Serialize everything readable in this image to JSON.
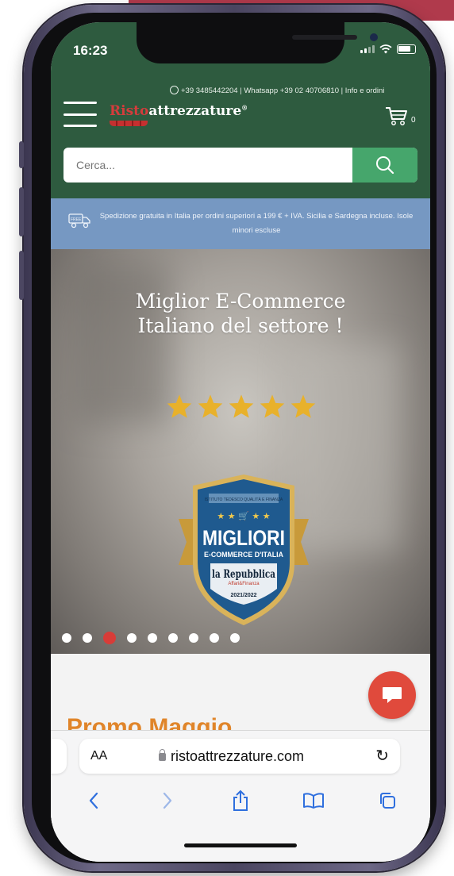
{
  "status_bar": {
    "time": "16:23"
  },
  "header": {
    "contact_text": "+39 3485442204 | Whatsapp  +39 02 40706810 | Info e ordini",
    "logo_brand_red": "Risto",
    "logo_brand_white": "attrezzature",
    "logo_mark": "®",
    "cart_count": "0"
  },
  "search": {
    "placeholder": "Cerca..."
  },
  "shipping_banner": {
    "text": "Spedizione gratuita in Italia per ordini superiori a 199 € + IVA. Sicilia e Sardegna incluse. Isole minori escluse",
    "truck_label": "FREE"
  },
  "hero": {
    "title_line1": "Miglior E-Commerce",
    "title_line2": "Italiano del settore !",
    "rating_stars": 5,
    "badge": {
      "top_text": "ISTITUTO TEDESCO QUALITÀ E FINANZA",
      "title": "MIGLIORI",
      "subtitle": "E-COMMERCE D'ITALIA",
      "publisher": "la Repubblica",
      "publisher_sub": "Affari&Finanza",
      "year": "2021/2022"
    },
    "carousel": {
      "total": 9,
      "active_index": 2
    }
  },
  "section": {
    "promo_heading": "Promo Maggio"
  },
  "browser": {
    "text_size_label": "AA",
    "url": "ristoattrezzature.com",
    "nav": [
      "back-icon",
      "forward-icon",
      "share-icon",
      "bookmarks-icon",
      "tabs-icon"
    ]
  },
  "colors": {
    "header_green": "#2e5b3f",
    "search_button": "#46a66c",
    "shipping_blue": "#7698c2",
    "promo_orange": "#e0852a",
    "chat_red": "#e04a3c",
    "carousel_active": "#d83c38",
    "star_gold": "#e8b12b"
  }
}
